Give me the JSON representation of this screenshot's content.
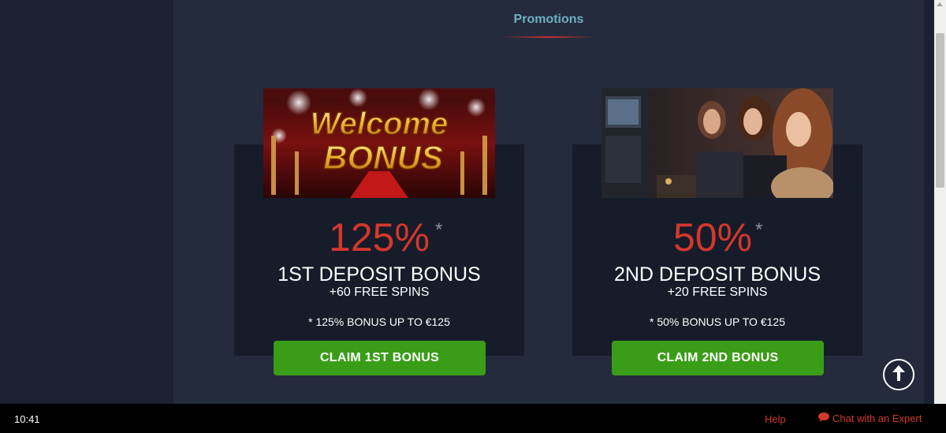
{
  "page": {
    "heading": "Promotions"
  },
  "promotions": [
    {
      "image_text_line1": "Welcome",
      "image_text_line2": "BONUS",
      "percent": "125%",
      "asterisk": "*",
      "title": "1ST DEPOSIT BONUS",
      "spins": "+60 FREE SPINS",
      "terms": "* 125% BONUS UP TO €125",
      "button_label": "CLAIM 1ST BONUS"
    },
    {
      "percent": "50%",
      "asterisk": "*",
      "title": "2ND DEPOSIT BONUS",
      "spins": "+20 FREE SPINS",
      "terms": "* 50% BONUS UP TO €125",
      "button_label": "CLAIM 2ND BONUS"
    }
  ],
  "status_bar": {
    "time": "10:41",
    "help_label": "Help",
    "chat_label": "Chat with an Expert"
  },
  "colors": {
    "accent_red": "#d4372c",
    "button_green": "#3a9d18",
    "heading_teal": "#6fb0c2"
  },
  "icons": {
    "scroll_top": "arrow-up-icon",
    "chat": "chat-bubble-icon"
  }
}
